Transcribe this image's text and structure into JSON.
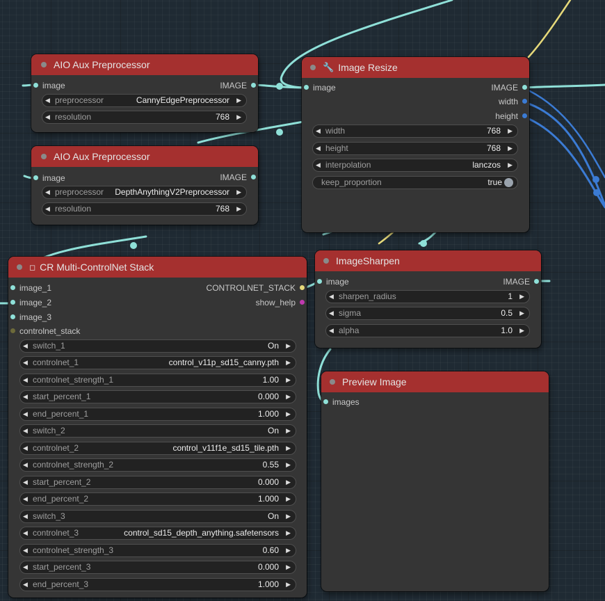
{
  "colors": {
    "canvas_bg": "#1f2a33",
    "node_bg": "#353535",
    "title_bar": "#a5302f",
    "image_link": "#8fe0d8",
    "int_link": "#3b7bd4",
    "stack_link": "#e6d97a"
  },
  "nodes": {
    "aio1": {
      "title": "AIO Aux Preprocessor",
      "input_image": "image",
      "output_image": "IMAGE",
      "widgets": [
        {
          "label": "preprocessor",
          "value": "CannyEdgePreprocessor"
        },
        {
          "label": "resolution",
          "value": "768"
        }
      ]
    },
    "aio2": {
      "title": "AIO Aux Preprocessor",
      "input_image": "image",
      "output_image": "IMAGE",
      "widgets": [
        {
          "label": "preprocessor",
          "value": "DepthAnythingV2Preprocessor"
        },
        {
          "label": "resolution",
          "value": "768"
        }
      ]
    },
    "resize": {
      "title": "Image Resize",
      "title_icon": "wrench-icon",
      "input_image": "image",
      "outputs": [
        "IMAGE",
        "width",
        "height"
      ],
      "widgets": [
        {
          "label": "width",
          "value": "768"
        },
        {
          "label": "height",
          "value": "768"
        },
        {
          "label": "interpolation",
          "value": "lanczos"
        },
        {
          "label": "keep_proportion",
          "value": "true"
        }
      ]
    },
    "stack": {
      "title": "CR Multi-ControlNet Stack",
      "title_icon": "square-icon",
      "inputs": [
        "image_1",
        "image_2",
        "image_3",
        "controlnet_stack"
      ],
      "outputs": [
        "CONTROLNET_STACK",
        "show_help"
      ],
      "widgets": [
        {
          "label": "switch_1",
          "value": "On"
        },
        {
          "label": "controlnet_1",
          "value": "control_v11p_sd15_canny.pth"
        },
        {
          "label": "controlnet_strength_1",
          "value": "1.00"
        },
        {
          "label": "start_percent_1",
          "value": "0.000"
        },
        {
          "label": "end_percent_1",
          "value": "1.000"
        },
        {
          "label": "switch_2",
          "value": "On"
        },
        {
          "label": "controlnet_2",
          "value": "control_v11f1e_sd15_tile.pth"
        },
        {
          "label": "controlnet_strength_2",
          "value": "0.55"
        },
        {
          "label": "start_percent_2",
          "value": "0.000"
        },
        {
          "label": "end_percent_2",
          "value": "1.000"
        },
        {
          "label": "switch_3",
          "value": "On"
        },
        {
          "label": "controlnet_3",
          "value": "control_sd15_depth_anything.safetensors"
        },
        {
          "label": "controlnet_strength_3",
          "value": "0.60"
        },
        {
          "label": "start_percent_3",
          "value": "0.000"
        },
        {
          "label": "end_percent_3",
          "value": "1.000"
        }
      ]
    },
    "sharpen": {
      "title": "ImageSharpen",
      "input_image": "image",
      "output_image": "IMAGE",
      "widgets": [
        {
          "label": "sharpen_radius",
          "value": "1"
        },
        {
          "label": "sigma",
          "value": "0.5"
        },
        {
          "label": "alpha",
          "value": "1.0"
        }
      ]
    },
    "preview": {
      "title": "Preview Image",
      "input_images": "images"
    }
  }
}
